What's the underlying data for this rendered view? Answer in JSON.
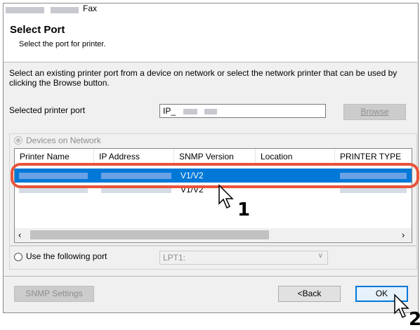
{
  "window": {
    "app_title": "Fax",
    "heading": "Select Port",
    "subheading": "Select the port for printer."
  },
  "instructions": "Select an existing printer port from a device on network or select the network printer that can be used by clicking the Browse button.",
  "selected_port": {
    "label": "Selected printer port",
    "value": "IP_",
    "browse_label": "Browse"
  },
  "devices": {
    "radio_label": "Devices on Network",
    "columns": [
      "Printer Name",
      "IP Address",
      "SNMP Version",
      "Location",
      "PRINTER TYPE"
    ],
    "rows": [
      {
        "snmp": "V1/V2",
        "selected": true
      },
      {
        "snmp": "V1/V2",
        "selected": false
      }
    ]
  },
  "use_port": {
    "radio_label": "Use the following port",
    "value": "LPT1:"
  },
  "footer": {
    "snmp_label": "SNMP Settings",
    "back_label": "<Back",
    "ok_label": "OK"
  },
  "callouts": {
    "one": "1",
    "two": "2"
  },
  "colors": {
    "accent": "#0078d7",
    "highlight": "#e8543a"
  }
}
